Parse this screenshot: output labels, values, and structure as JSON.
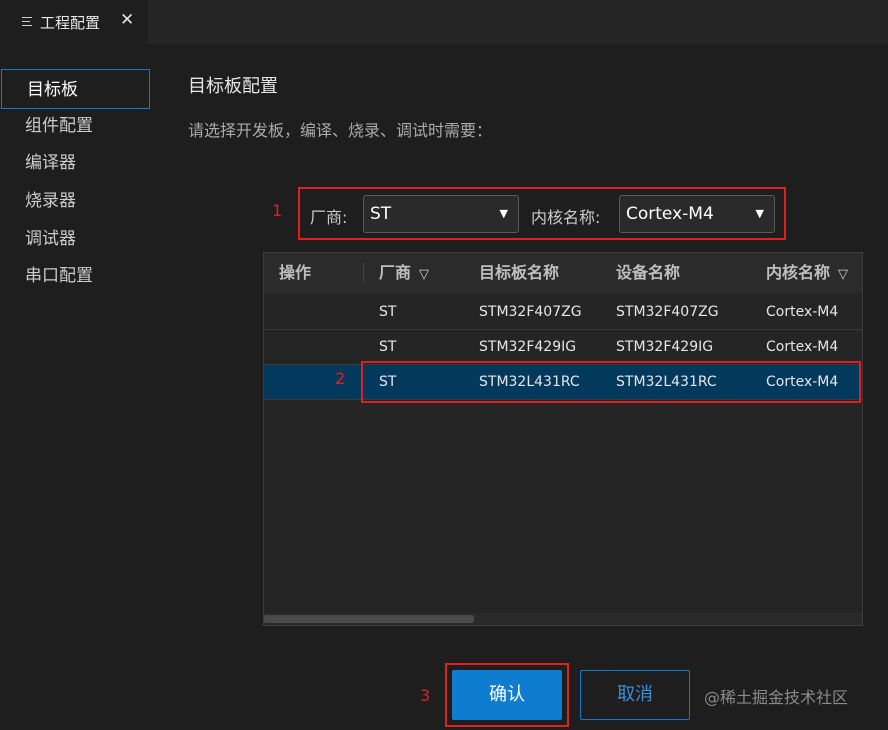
{
  "tab": {
    "title": "工程配置",
    "close": "✕"
  },
  "sidebar": {
    "items": [
      {
        "label": "目标板",
        "active": true
      },
      {
        "label": "组件配置"
      },
      {
        "label": "编译器"
      },
      {
        "label": "烧录器"
      },
      {
        "label": "调试器"
      },
      {
        "label": "串口配置"
      }
    ]
  },
  "page": {
    "title": "目标板配置",
    "description": "请选择开发板，编译、烧录、调试时需要："
  },
  "filters": {
    "vendor_label": "厂商:",
    "vendor_value": "ST",
    "core_label": "内核名称:",
    "core_value": "Cortex-M4"
  },
  "table": {
    "columns": [
      "操作",
      "厂商",
      "目标板名称",
      "设备名称",
      "内核名称"
    ],
    "rows": [
      {
        "action": "",
        "vendor": "ST",
        "board": "STM32F407ZG",
        "device": "STM32F407ZG",
        "core": "Cortex-M4",
        "selected": false
      },
      {
        "action": "",
        "vendor": "ST",
        "board": "STM32F429IG",
        "device": "STM32F429IG",
        "core": "Cortex-M4",
        "selected": false
      },
      {
        "action": "",
        "vendor": "ST",
        "board": "STM32L431RC",
        "device": "STM32L431RC",
        "core": "Cortex-M4",
        "selected": true
      }
    ]
  },
  "annotations": {
    "one": "1",
    "two": "2",
    "three": "3"
  },
  "buttons": {
    "confirm": "确认",
    "cancel": "取消"
  },
  "watermark": "@稀土掘金技术社区",
  "colors": {
    "accent": "#0e7dd0",
    "selected_row": "#04395e",
    "annotation": "#e02020"
  }
}
